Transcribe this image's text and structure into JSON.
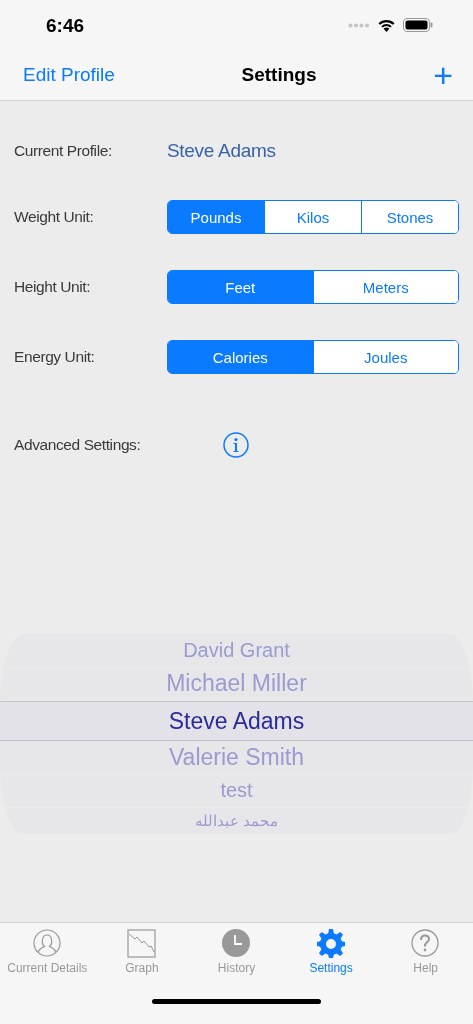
{
  "status_bar": {
    "time": "6:46"
  },
  "nav": {
    "left": "Edit Profile",
    "title": "Settings",
    "right": "+"
  },
  "current_profile": {
    "label": "Current Profile:",
    "value": "Steve Adams"
  },
  "unit_rows": [
    {
      "label": "Weight Unit:",
      "segments": [
        {
          "label": "Pounds",
          "selected": true
        },
        {
          "label": "Kilos",
          "selected": false
        },
        {
          "label": "Stones",
          "selected": false
        }
      ]
    },
    {
      "label": "Height Unit:",
      "segments": [
        {
          "label": "Feet",
          "selected": true
        },
        {
          "label": "Meters",
          "selected": false
        }
      ]
    },
    {
      "label": "Energy Unit:",
      "segments": [
        {
          "label": "Calories",
          "selected": true
        },
        {
          "label": "Joules",
          "selected": false
        }
      ]
    }
  ],
  "advanced": {
    "label": "Advanced Settings:"
  },
  "picker": [
    {
      "label": "David Grant",
      "selected": false
    },
    {
      "label": "Michael Miller",
      "selected": false
    },
    {
      "label": "Steve Adams",
      "selected": true
    },
    {
      "label": "Valerie Smith",
      "selected": false
    },
    {
      "label": "test",
      "selected": false
    },
    {
      "label": "محمد عبدالله",
      "selected": false
    }
  ],
  "tabs": [
    {
      "label": "Current Details",
      "kind": "person",
      "selected": false
    },
    {
      "label": "Graph",
      "kind": "graph",
      "selected": false
    },
    {
      "label": "History",
      "kind": "clock",
      "selected": false
    },
    {
      "label": "Settings",
      "kind": "gear",
      "selected": true
    },
    {
      "label": "Help",
      "kind": "help",
      "selected": false
    }
  ]
}
